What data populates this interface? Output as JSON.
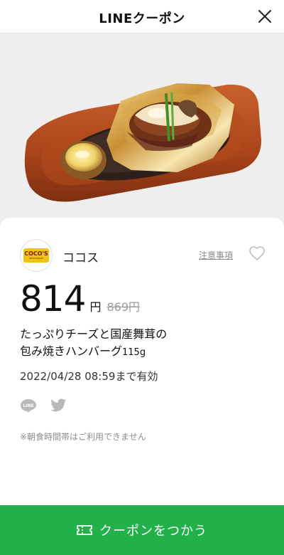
{
  "header": {
    "title": "LINEクーポン",
    "close_icon": "close-icon"
  },
  "coupon": {
    "logo": {
      "brand_text": "COCO'S",
      "sub_text": "RESTAURANT",
      "color_bg": "#f0c417",
      "color_text": "#7a1a10"
    },
    "store_name": "ココス",
    "notes_link": "注意事項",
    "favorite_icon": "heart-icon",
    "price": "814",
    "price_unit": "円",
    "original_price": "869円",
    "product_name_line1": "たっぷりチーズと国産舞茸の",
    "product_name_line2": "包み焼きハンバーグ",
    "product_weight": "115g",
    "expiry": "2022/04/28  08:59まで有効",
    "share_icons": [
      "line-share-icon",
      "twitter-share-icon"
    ],
    "notice": "※朝食時間帯はご利用できません"
  },
  "action": {
    "use_button_label": "クーポンをつかう",
    "ticket_icon": "ticket-icon",
    "color": "#21b04a"
  }
}
